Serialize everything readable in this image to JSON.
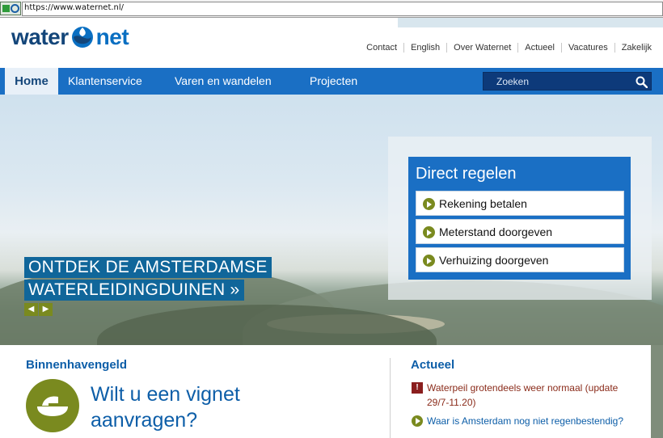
{
  "browser": {
    "url": "https://www.waternet.nl/"
  },
  "header": {
    "logo_water": "water",
    "logo_net": "net",
    "utility_nav": [
      "Contact",
      "English",
      "Over Waternet",
      "Actueel",
      "Vacatures",
      "Zakelijk"
    ]
  },
  "main_nav": {
    "home": "Home",
    "items": [
      "Klantenservice",
      "Varen en wandelen",
      "Projecten"
    ],
    "search_placeholder": "Zoeken"
  },
  "hero": {
    "promo_line1": "ONTDEK DE AMSTERDAMSE",
    "promo_line2": "WATERLEIDINGDUINEN »"
  },
  "direct_regelen": {
    "title": "Direct regelen",
    "items": [
      "Rekening betalen",
      "Meterstand doorgeven",
      "Verhuizing doorgeven"
    ]
  },
  "content": {
    "left_heading": "Binnenhavengeld",
    "left_text": "Wilt u een vignet aanvragen?",
    "right_heading": "Actueel",
    "news": [
      "Waterpeil grotendeels weer normaal (update 29/7-11.20)",
      "Waar is Amsterdam nog niet regenbestendig?"
    ]
  },
  "colors": {
    "nav_blue": "#1a6fc4",
    "brand_dark": "#14467a",
    "olive": "#7a8a1f",
    "news_red": "#8a2b1a"
  }
}
